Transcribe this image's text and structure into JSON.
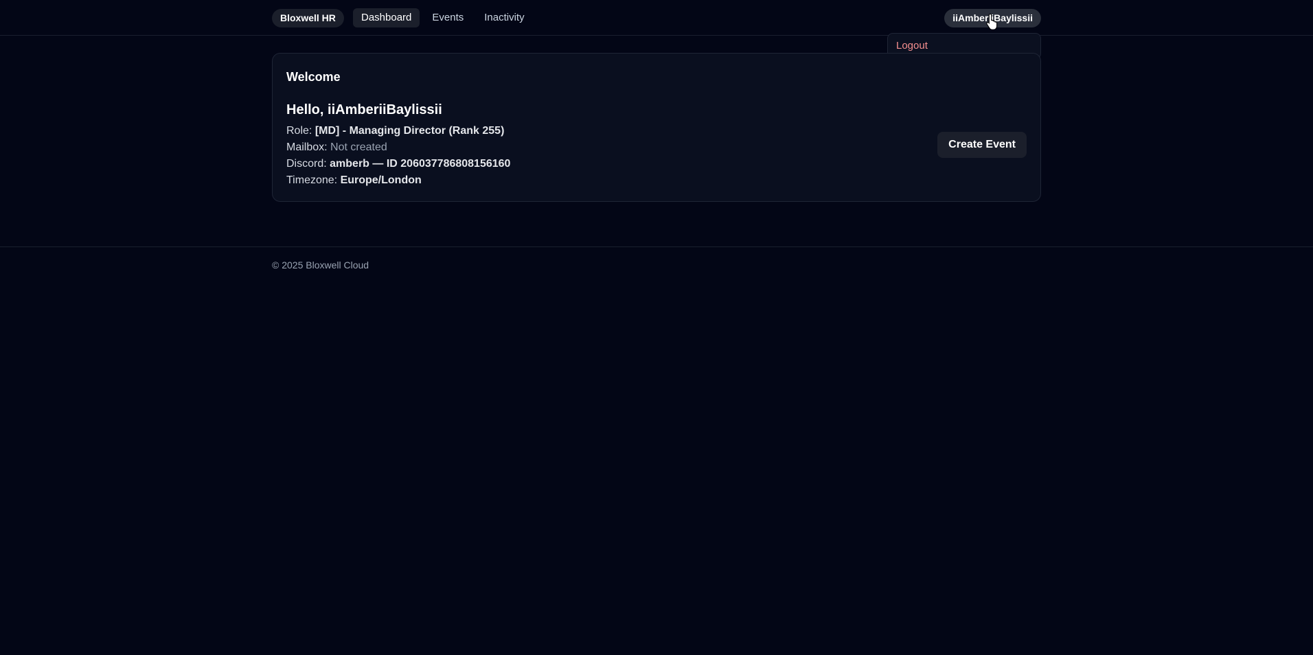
{
  "header": {
    "brand": "Bloxwell HR",
    "nav": [
      {
        "label": "Dashboard",
        "active": true
      },
      {
        "label": "Events",
        "active": false
      },
      {
        "label": "Inactivity",
        "active": false
      }
    ],
    "user": "iiAmberiiBaylissii",
    "dropdown": {
      "logout": "Logout"
    }
  },
  "welcome": {
    "title": "Welcome",
    "greeting": "Hello, iiAmberiiBaylissii",
    "role_label": "Role:",
    "role_value": "[MD] - Managing Director (Rank 255)",
    "mailbox_label": "Mailbox:",
    "mailbox_value": "Not created",
    "discord_label": "Discord:",
    "discord_value": "amberb — ID 206037786808156160",
    "timezone_label": "Timezone:",
    "timezone_value": "Europe/London",
    "create_event": "Create Event"
  },
  "footer": {
    "text": "© 2025 Bloxwell Cloud"
  },
  "colors": {
    "background": "#030616",
    "card": "#0a0f1f",
    "logout": "#f58f8f"
  }
}
